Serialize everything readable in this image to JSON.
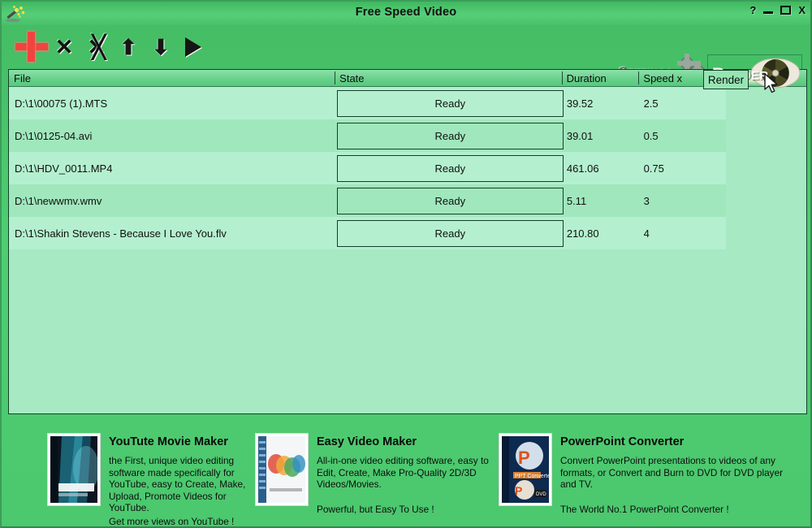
{
  "window": {
    "title": "Free Speed Video",
    "app_icon": "magic-wand-icon",
    "controls": {
      "help": "?",
      "minimize": "–",
      "maximize": "□",
      "close": "X"
    }
  },
  "toolbar": {
    "add": "add-file-plus-icon",
    "remove": "remove-file-x-icon",
    "remove_all": "remove-all-double-x-icon",
    "move_up": "⬆",
    "move_down": "⬇",
    "play": "play-triangle-icon",
    "settings_label": "Settings",
    "render_label": "Render"
  },
  "tooltip": {
    "text": "Render"
  },
  "list": {
    "columns": [
      "File",
      "State",
      "Duration",
      "Speed x"
    ],
    "rows": [
      {
        "file": "D:\\1\\00075 (1).MTS",
        "state": "Ready",
        "duration": "39.52",
        "speed": "2.5"
      },
      {
        "file": "D:\\1\\0125-04.avi",
        "state": "Ready",
        "duration": "39.01",
        "speed": "0.5"
      },
      {
        "file": "D:\\1\\HDV_0011.MP4",
        "state": "Ready",
        "duration": "461.06",
        "speed": "0.75"
      },
      {
        "file": "D:\\1\\newwmv.wmv",
        "state": "Ready",
        "duration": "5.11",
        "speed": "3"
      },
      {
        "file": "D:\\1\\Shakin Stevens - Because I Love You.flv",
        "state": "Ready",
        "duration": "210.80",
        "speed": "4"
      }
    ]
  },
  "promos": [
    {
      "title": "YouTute Movie Maker",
      "body": "the First, unique video editing software made specifically for YouTube, easy to Create, Make, Upload, Promote Videos for YouTube.",
      "footer": "Get more views on YouTube !",
      "boxart": "youtube-movie-maker-boxart"
    },
    {
      "title": "Easy Video Maker",
      "body": "All-in-one video editing software, easy to Edit, Create, Make Pro-Quality 2D/3D Videos/Movies.",
      "footer": "Powerful, but Easy To Use !",
      "boxart": "easy-video-maker-boxart"
    },
    {
      "title": "PowerPoint Converter",
      "body": "Convert PowerPoint presentations to videos of any formats, or Convert and Burn to DVD for DVD player and TV.",
      "footer": "The World No.1 PowerPoint Converter !",
      "boxart": "powerpoint-converter-boxart"
    }
  ],
  "colors": {
    "window_green": "#4cc86e",
    "list_row_light": "#b4f0cf",
    "list_row_dark": "#a0e7bd",
    "add_icon_red": "#f0453f",
    "border_dark": "#14402a"
  }
}
